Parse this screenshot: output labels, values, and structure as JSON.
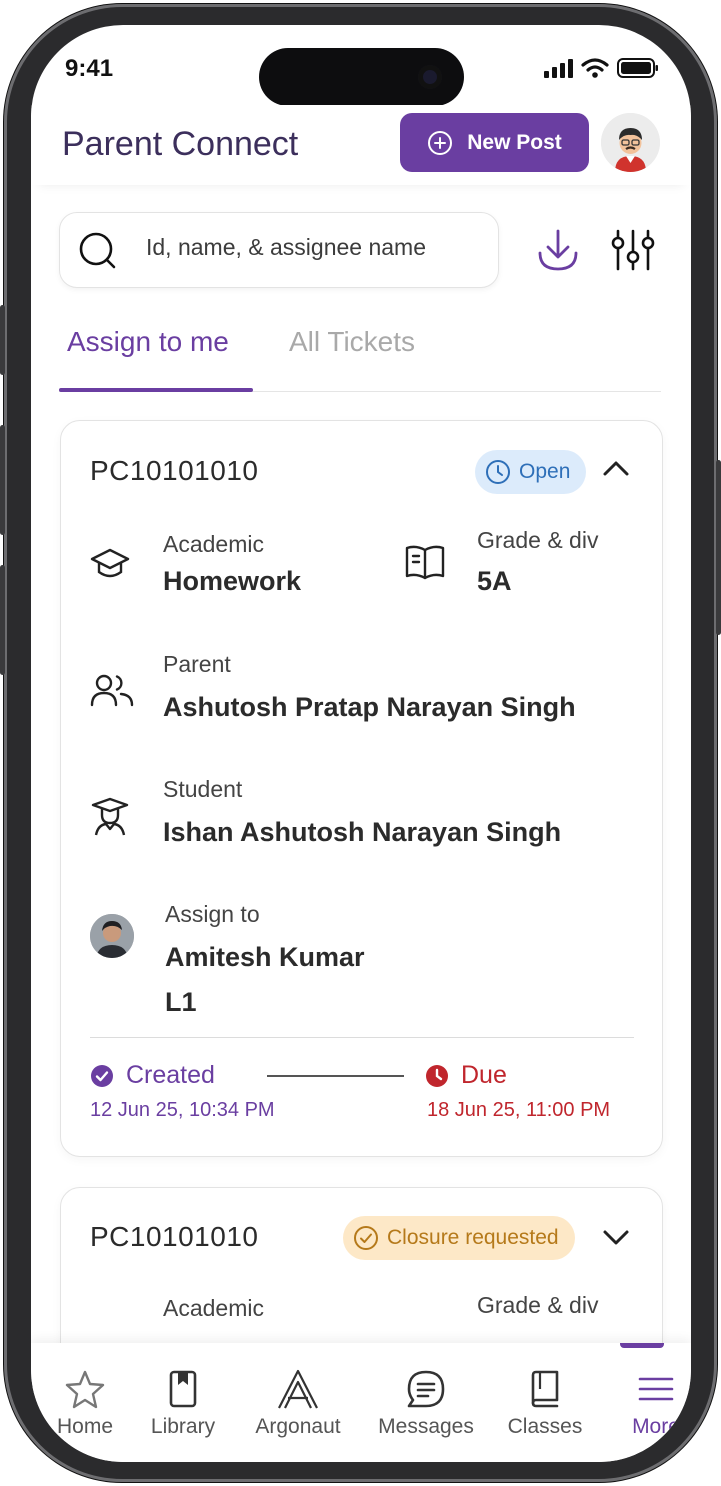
{
  "status_bar": {
    "time": "9:41"
  },
  "header": {
    "title": "Parent Connect",
    "new_post_label": "New Post"
  },
  "search": {
    "placeholder": "Id, name, & assignee name"
  },
  "tabs": [
    {
      "label": "Assign to me",
      "active": true
    },
    {
      "label": "All Tickets",
      "active": false
    }
  ],
  "tickets": [
    {
      "id": "PC10101010",
      "status": "Open",
      "category_label": "Academic",
      "category_value": "Homework",
      "grade_label": "Grade & div",
      "grade_value": "5A",
      "parent_label": "Parent",
      "parent_value": "Ashutosh Pratap Narayan Singh",
      "student_label": "Student",
      "student_value": "Ishan Ashutosh Narayan Singh",
      "assign_label": "Assign to",
      "assign_name": "Amitesh Kumar",
      "assign_level": "L1",
      "created_label": "Created",
      "created_date": "12 Jun 25, 10:34 PM",
      "due_label": "Due",
      "due_date": "18 Jun 25, 11:00 PM"
    },
    {
      "id": "PC10101010",
      "status": "Closure requested",
      "category_label": "Academic",
      "grade_label": "Grade & div"
    }
  ],
  "bottom_nav": [
    {
      "label": "Home",
      "icon": "star-icon"
    },
    {
      "label": "Library",
      "icon": "bookmark-book-icon"
    },
    {
      "label": "Argonaut",
      "icon": "argonaut-logo-icon"
    },
    {
      "label": "Messages",
      "icon": "message-icon"
    },
    {
      "label": "Classes",
      "icon": "book-icon"
    },
    {
      "label": "More",
      "icon": "menu-icon",
      "active": true
    }
  ],
  "colors": {
    "accent": "#6a3ea1",
    "due": "#c0262d",
    "open_badge": "#dcebfb",
    "closure_badge": "#fde8c7"
  }
}
